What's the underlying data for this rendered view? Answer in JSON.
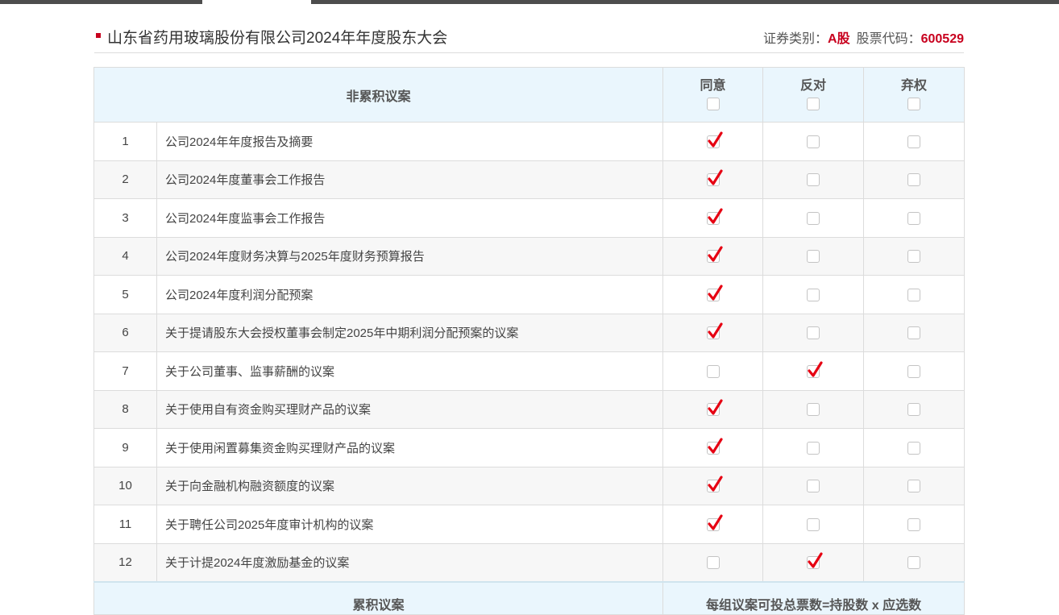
{
  "header": {
    "title": "山东省药用玻璃股份有限公司2024年年度股东大会",
    "security_type_label": "证券类别：",
    "security_type_value": "A股",
    "stock_code_label": "股票代码：",
    "stock_code_value": "600529"
  },
  "table": {
    "section_title": "非累积议案",
    "columns": {
      "agree": "同意",
      "oppose": "反对",
      "abstain": "弃权"
    },
    "rows": [
      {
        "no": "1",
        "title": "公司2024年年度报告及摘要",
        "vote": "agree"
      },
      {
        "no": "2",
        "title": "公司2024年度董事会工作报告",
        "vote": "agree"
      },
      {
        "no": "3",
        "title": "公司2024年度监事会工作报告",
        "vote": "agree"
      },
      {
        "no": "4",
        "title": "公司2024年度财务决算与2025年度财务预算报告",
        "vote": "agree"
      },
      {
        "no": "5",
        "title": "公司2024年度利润分配预案",
        "vote": "agree"
      },
      {
        "no": "6",
        "title": "关于提请股东大会授权董事会制定2025年中期利润分配预案的议案",
        "vote": "agree"
      },
      {
        "no": "7",
        "title": "关于公司董事、监事薪酬的议案",
        "vote": "oppose"
      },
      {
        "no": "8",
        "title": "关于使用自有资金购买理财产品的议案",
        "vote": "agree"
      },
      {
        "no": "9",
        "title": "关于使用闲置募集资金购买理财产品的议案",
        "vote": "agree"
      },
      {
        "no": "10",
        "title": "关于向金融机构融资额度的议案",
        "vote": "agree"
      },
      {
        "no": "11",
        "title": "关于聘任公司2025年度审计机构的议案",
        "vote": "agree"
      },
      {
        "no": "12",
        "title": "关于计提2024年度激励基金的议案",
        "vote": "oppose"
      }
    ],
    "footer": {
      "section_title": "累积议案",
      "note": "每组议案可投总票数=持股数 x 应选数"
    }
  },
  "colors": {
    "accent_red": "#c8001e",
    "header_bg": "#eaf6fd",
    "check_red": "#e60012",
    "topbar": "#4d4d4d"
  },
  "icons": {
    "checked": "red-checkmark-icon",
    "unchecked": "empty-checkbox-icon"
  }
}
